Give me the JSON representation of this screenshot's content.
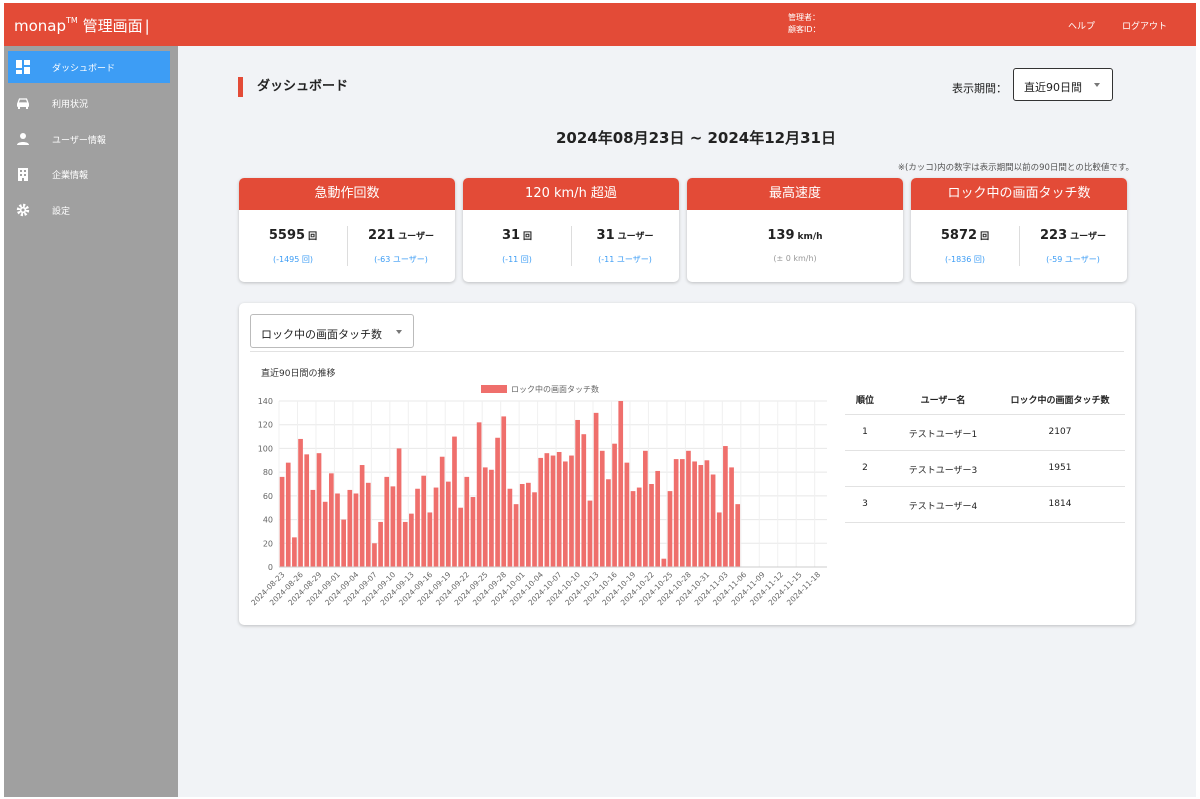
{
  "header": {
    "brand": "monap",
    "brand_tm": "TM",
    "brand_suffix": "管理画面",
    "admin_label": "管理者：",
    "customer_id_label": "顧客ID：",
    "help": "ヘルプ",
    "logout": "ログアウト"
  },
  "sidebar": {
    "items": [
      {
        "label": "ダッシュボード",
        "icon": "dashboard-icon"
      },
      {
        "label": "利用状況",
        "icon": "car-icon"
      },
      {
        "label": "ユーザー情報",
        "icon": "person-icon"
      },
      {
        "label": "企業情報",
        "icon": "building-icon"
      },
      {
        "label": "設定",
        "icon": "gear-icon"
      }
    ],
    "active": 0
  },
  "main": {
    "title": "ダッシュボード",
    "period_label": "表示期間：",
    "period_value": "直近90日間",
    "date_range": "2024年08月23日 ~ 2024年12月31日",
    "note": "※(カッコ)内の数字は表示期間以前の90日間との比較値です。"
  },
  "cards": [
    {
      "title": "急動作回数",
      "left": {
        "value": "5595",
        "unit": "回",
        "diff": "(-1495 回)"
      },
      "right": {
        "value": "221",
        "unit": "ユーザー",
        "diff": "(-63 ユーザー)"
      }
    },
    {
      "title": "120 km/h 超過",
      "left": {
        "value": "31",
        "unit": "回",
        "diff": "(-11 回)"
      },
      "right": {
        "value": "31",
        "unit": "ユーザー",
        "diff": "(-11 ユーザー)"
      }
    },
    {
      "title": "最高速度",
      "full": {
        "value": "139",
        "unit": "km/h",
        "diff": "(± 0 km/h)"
      }
    },
    {
      "title": "ロック中の画面タッチ数",
      "left": {
        "value": "5872",
        "unit": "回",
        "diff": "(-1836 回)"
      },
      "right": {
        "value": "223",
        "unit": "ユーザー",
        "diff": "(-59 ユーザー)"
      }
    }
  ],
  "panel": {
    "metric_value": "ロック中の画面タッチ数",
    "chart_title": "直近90日間の推移"
  },
  "ranking": {
    "headers": [
      "順位",
      "ユーザー名",
      "ロック中の画面タッチ数"
    ],
    "rows": [
      [
        "1",
        "テストユーザー1",
        "2107"
      ],
      [
        "2",
        "テストユーザー3",
        "1951"
      ],
      [
        "3",
        "テストユーザー4",
        "1814"
      ]
    ]
  },
  "colors": {
    "accent": "#e34b37",
    "active_nav": "#3d9df5",
    "bar": "#ef6f6c"
  },
  "chart_data": {
    "type": "bar",
    "legend": "ロック中の画面タッチ数",
    "legend_position": "top",
    "ylim": [
      0,
      140
    ],
    "yticks": [
      0,
      20,
      40,
      60,
      80,
      100,
      120,
      140
    ],
    "grid": true,
    "x_tick_labels": [
      "2024-08-23",
      "2024-08-26",
      "2024-08-29",
      "2024-09-01",
      "2024-09-04",
      "2024-09-07",
      "2024-09-10",
      "2024-09-13",
      "2024-09-16",
      "2024-09-19",
      "2024-09-22",
      "2024-09-25",
      "2024-09-28",
      "2024-10-01",
      "2024-10-04",
      "2024-10-07",
      "2024-10-10",
      "2024-10-13",
      "2024-10-16",
      "2024-10-19",
      "2024-10-22",
      "2024-10-25",
      "2024-10-28",
      "2024-10-31",
      "2024-11-03",
      "2024-11-06",
      "2024-11-09",
      "2024-11-12",
      "2024-11-15",
      "2024-11-18"
    ],
    "x_start": "2024-08-23",
    "values": [
      76,
      88,
      25,
      108,
      95,
      65,
      96,
      55,
      79,
      62,
      40,
      65,
      62,
      86,
      71,
      20,
      38,
      76,
      68,
      100,
      38,
      45,
      66,
      77,
      46,
      67,
      93,
      72,
      110,
      50,
      76,
      59,
      122,
      84,
      82,
      109,
      127,
      66,
      53,
      70,
      71,
      63,
      92,
      96,
      94,
      97,
      89,
      94,
      124,
      112,
      56,
      130,
      98,
      74,
      104,
      140,
      88,
      64,
      67,
      98,
      70,
      81,
      7,
      64,
      91,
      91,
      98,
      89,
      86,
      90,
      78,
      46,
      102,
      84,
      53,
      null,
      null,
      null,
      null,
      null,
      null,
      null,
      null,
      null,
      null,
      null,
      null,
      null,
      null
    ]
  }
}
